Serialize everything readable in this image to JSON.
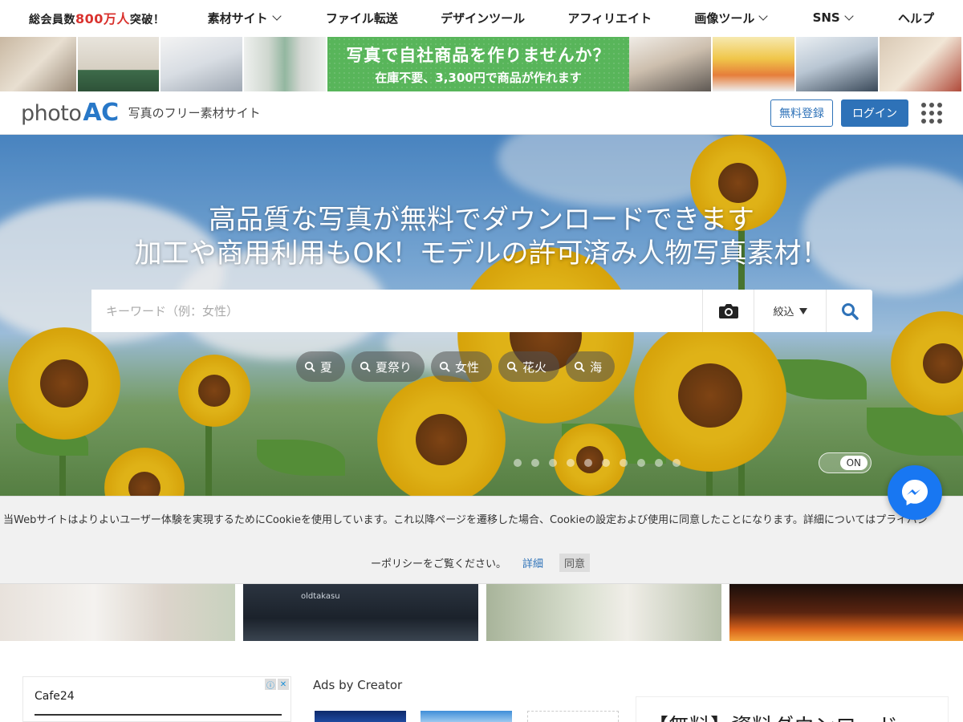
{
  "topnav": {
    "promo_prefix": "総会員数",
    "promo_highlight": "800万人",
    "promo_suffix": "突破！",
    "items": [
      {
        "label": "素材サイト",
        "dropdown": true
      },
      {
        "label": "ファイル転送",
        "dropdown": false
      },
      {
        "label": "デザインツール",
        "dropdown": false
      },
      {
        "label": "アフィリエイト",
        "dropdown": false
      },
      {
        "label": "画像ツール",
        "dropdown": true
      },
      {
        "label": "SNS",
        "dropdown": true
      },
      {
        "label": "ヘルプ",
        "dropdown": false
      }
    ]
  },
  "banner": {
    "line1": "写真で自社商品を作りませんか？",
    "line2": "在庫不要、3,300円で商品が作れます"
  },
  "header": {
    "logo_photo": "photo",
    "logo_ac": "AC",
    "tagline": "写真のフリー素材サイト",
    "register_label": "無料登録",
    "login_label": "ログイン"
  },
  "hero": {
    "title_line1": "高品質な写真が無料でダウンロードできます",
    "title_line2": "加工や商用利用もOK！モデルの許可済み人物写真素材！",
    "search_placeholder": "キーワード（例：女性）",
    "filter_label": "絞込",
    "chips": [
      "夏",
      "夏祭り",
      "女性",
      "花火",
      "海"
    ],
    "toggle_label": "ON",
    "slide_count": 10
  },
  "cookie": {
    "text_line1": "当Webサイトはよりよいユーザー体験を実現するためにCookieを使用しています。これ以降ページを遷移した場合、Cookieの設定および使用に同意したことになります。詳細についてはプライバシ",
    "text_line2": "ーポリシーをご覧ください。",
    "details_label": "詳細",
    "agree_label": "同意"
  },
  "thumbs": {
    "overlay_text": "oldtakasu"
  },
  "ad": {
    "name": "Cafe24"
  },
  "creator": {
    "heading": "Ads by Creator"
  },
  "side": {
    "text": "【無料】資料ダウンロード"
  },
  "colors": {
    "brand_blue": "#2e72b8",
    "promo_red": "#d9322e",
    "banner_green": "#58b55a",
    "messenger_blue": "#1877f2"
  }
}
